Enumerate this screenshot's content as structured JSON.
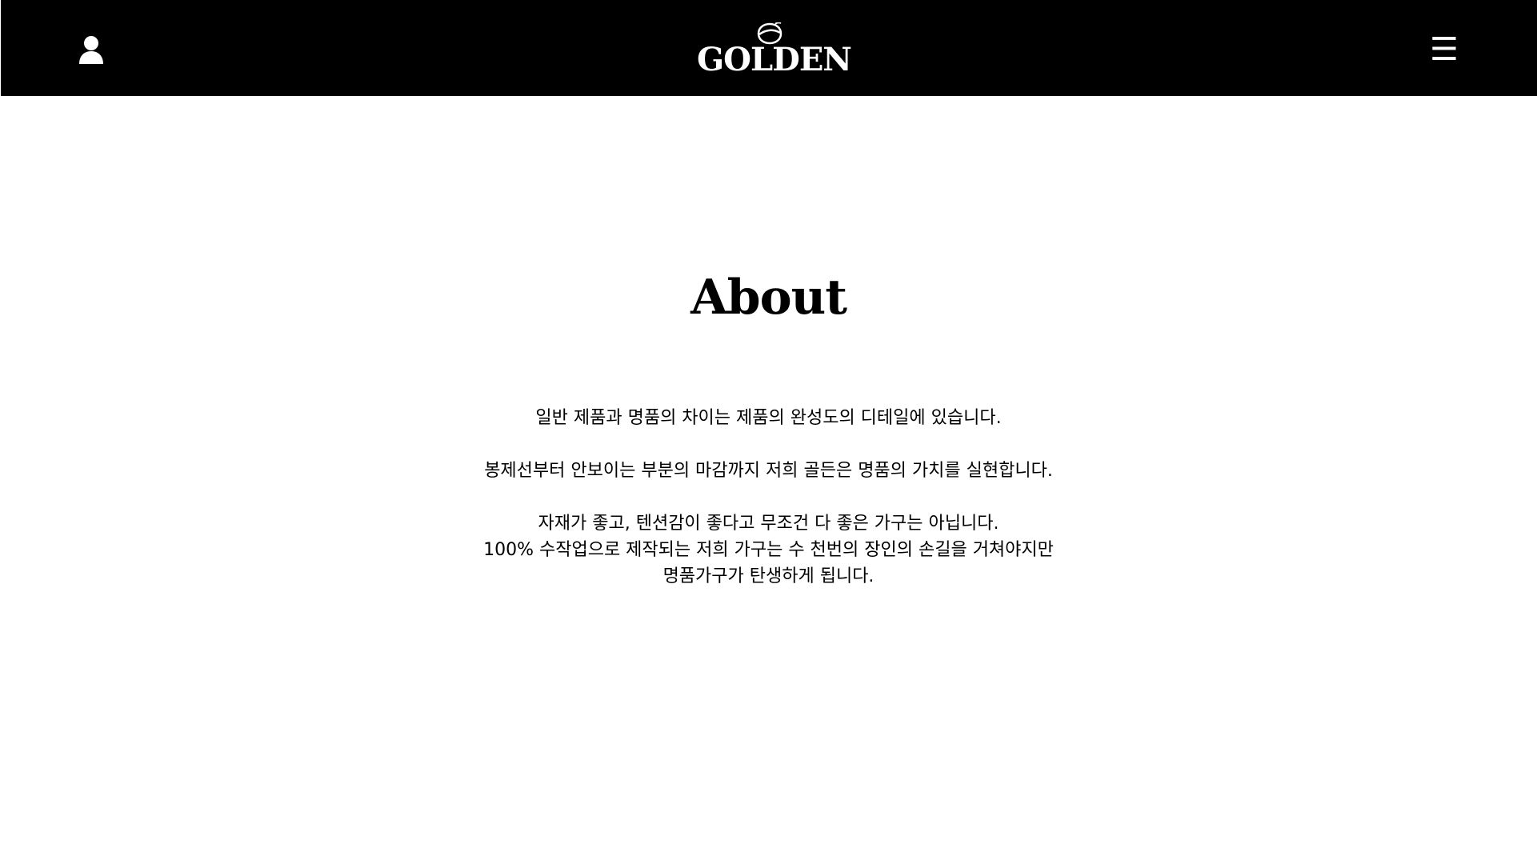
{
  "header": {
    "logo_text": "GOLDEN",
    "menu_icon_glyph": "☰",
    "background": "#000000",
    "foreground": "#ffffff"
  },
  "icons": {
    "user": "user-icon",
    "menu": "hamburger-menu-icon",
    "logo_leaf": "leaf-icon"
  },
  "main": {
    "title": "About",
    "paragraphs": [
      "일반 제품과 명품의 차이는 제품의 완성도의 디테일에 있습니다.",
      "봉제선부터 안보이는 부분의 마감까지 저희 골든은 명품의 가치를 실현합니다.",
      "자재가 좋고, 텐션감이 좋다고 무조건 다 좋은 가구는 아닙니다.",
      "100% 수작업으로 제작되는 저희 가구는 수 천번의 장인의 손길을 거쳐야지만",
      "명품가구가 탄생하게 됩니다."
    ]
  }
}
